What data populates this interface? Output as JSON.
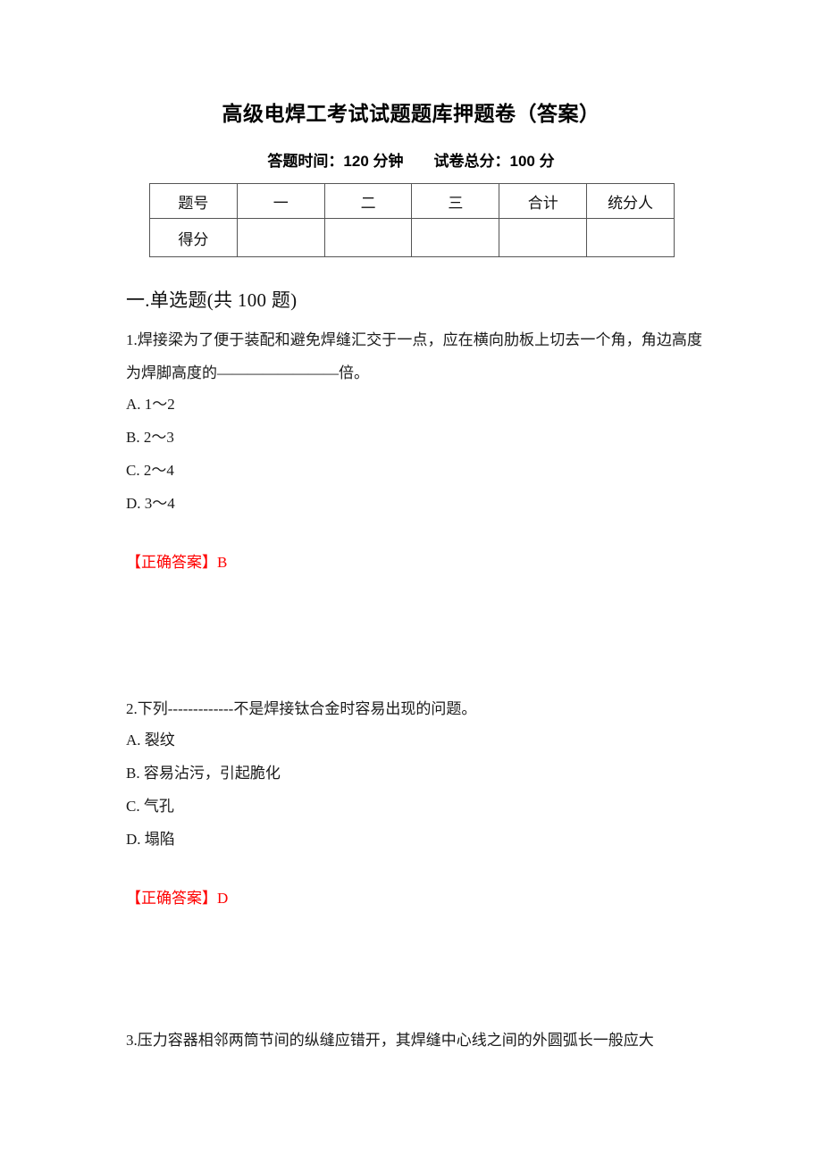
{
  "document": {
    "title": "高级电焊工考试试题题库押题卷（答案）",
    "subtitle": "答题时间：120 分钟　　试卷总分：100 分"
  },
  "score_table": {
    "header_row": [
      "题号",
      "一",
      "二",
      "三",
      "合计",
      "统分人"
    ],
    "score_row": [
      "得分",
      "",
      "",
      "",
      "",
      ""
    ]
  },
  "section": {
    "heading": "一.单选题(共 100 题)"
  },
  "questions": [
    {
      "stem": "1.焊接梁为了便于装配和避免焊缝汇交于一点，应在横向肋板上切去一个角，角边高度为焊脚高度的————————倍。",
      "options": [
        "A. 1～2",
        "B. 2～3",
        "C. 2～4",
        "D. 3～4"
      ],
      "answer_label": "【正确答案】",
      "answer_value": "B"
    },
    {
      "stem": "2.下列-------------不是焊接钛合金时容易出现的问题。",
      "options": [
        "A. 裂纹",
        "B. 容易沾污，引起脆化",
        "C. 气孔",
        "D. 塌陷"
      ],
      "answer_label": "【正确答案】",
      "answer_value": "D"
    },
    {
      "stem": "3.压力容器相邻两筒节间的纵缝应错开，其焊缝中心线之间的外圆弧长一般应大",
      "options": [],
      "answer_label": "",
      "answer_value": ""
    }
  ],
  "colors": {
    "answer_red": "#ff0000",
    "text": "#1a1a1a",
    "table_border": "#555555"
  }
}
